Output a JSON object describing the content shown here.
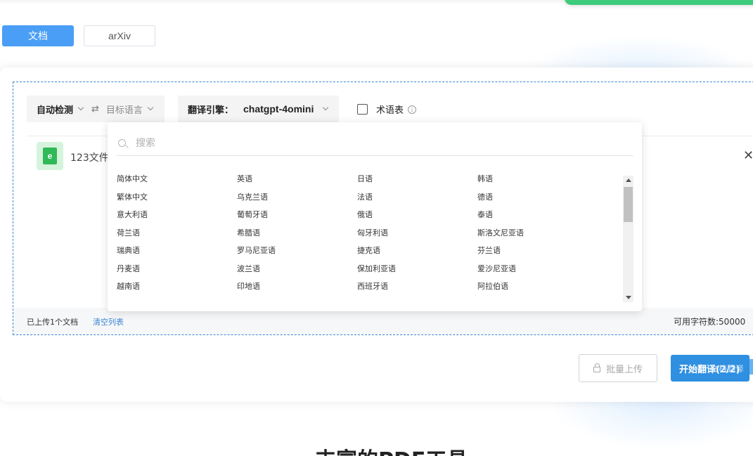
{
  "tabs": [
    {
      "label": "文档",
      "active": true
    },
    {
      "label": "arXiv",
      "active": false
    }
  ],
  "language_selector": {
    "source": "自动检测",
    "swap_symbol": "⇄",
    "target_placeholder": "目标语言"
  },
  "engine_selector": {
    "label": "翻译引擎：",
    "value": "chatgpt-4omini"
  },
  "glossary": {
    "label": "术语表",
    "checked": false,
    "info_symbol": "i"
  },
  "file": {
    "icon_letter": "e",
    "name": "123文件."
  },
  "close_symbol": "✕",
  "dropdown": {
    "search_placeholder": "搜索",
    "languages": [
      "简体中文",
      "英语",
      "日语",
      "韩语",
      "繁体中文",
      "乌克兰语",
      "法语",
      "德语",
      "意大利语",
      "葡萄牙语",
      "俄语",
      "泰语",
      "荷兰语",
      "希腊语",
      "匈牙利语",
      "斯洛文尼亚语",
      "瑞典语",
      "罗马尼亚语",
      "捷克语",
      "芬兰语",
      "丹麦语",
      "波兰语",
      "保加利亚语",
      "爱沙尼亚语",
      "越南语",
      "印地语",
      "西班牙语",
      "阿拉伯语"
    ]
  },
  "footer": {
    "uploaded_count": "已上传1个文档",
    "clear_list": "清空列表",
    "available_chars": "可用字符数:50000"
  },
  "actions": {
    "batch_upload": "批量上传",
    "start_translate": "开始翻译(2/2)",
    "start_overlay": "文档翻译"
  },
  "bottom_heading": "丰富的PDF工具",
  "colors": {
    "primary": "#2f8fe0",
    "tab_active": "#4a9ef6",
    "toast": "#3dcb7c",
    "file_icon": "#2fb957",
    "link": "#3a84d4"
  }
}
